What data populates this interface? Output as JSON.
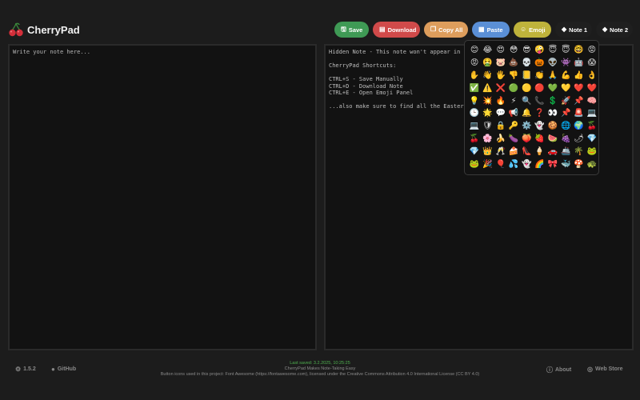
{
  "app": {
    "title": "CherryPad"
  },
  "toolbar": {
    "save": "Save",
    "download": "Download",
    "copy_all": "Copy All",
    "paste": "Paste",
    "emoji": "Emoji",
    "note1": "Note 1",
    "note2": "Note 2"
  },
  "colors": {
    "save": "#3f9a55",
    "download": "#d04a4a",
    "copy_all": "#dd9d5c",
    "paste": "#5a8fd6",
    "emoji": "#bfb33b",
    "background": "#1c1c1c",
    "panel": "#121212",
    "last_saved": "#4fb04f"
  },
  "icons": {
    "save": "floppy-disk-icon",
    "download": "file-arrow-down-icon",
    "copy_all": "copy-icon",
    "paste": "clipboard-icon",
    "emoji": "face-smile-icon",
    "note": "eraser-icon",
    "version": "gear-icon",
    "github": "github-icon",
    "about": "info-circle-icon",
    "webstore": "chrome-icon",
    "logo": "cherry-icon"
  },
  "left_note": {
    "placeholder": "Write your note here...",
    "value": ""
  },
  "right_note": {
    "content": "Hidden Note - This note won't appear in th\n\nCherryPad Shortcuts:\n\nCTRL+S - Save Manually\nCTRL+D - Download Note\nCTRL+E - Open Emoji Panel\n\n...also make sure to find all the Easter E"
  },
  "emoji_panel": {
    "emojis": [
      "😊",
      "😂",
      "😍",
      "😳",
      "😎",
      "🤪",
      "😇",
      "😇",
      "🤓",
      "😡",
      "😡",
      "🤮",
      "🐷",
      "💩",
      "💀",
      "🎃",
      "👽",
      "👾",
      "🤖",
      "😱",
      "✋",
      "👋",
      "🖐",
      "👎",
      "📒",
      "👏",
      "🙏",
      "💪",
      "👍",
      "👌",
      "✅",
      "⚠️",
      "❌",
      "🟢",
      "🟡",
      "🔴",
      "💚",
      "💛",
      "❤️",
      "❤️",
      "💡",
      "💥",
      "🔥",
      "⚡",
      "🔍",
      "📞",
      "💲",
      "🚀",
      "📌",
      "🧠",
      "🕒",
      "🌟",
      "💬",
      "📢",
      "🔔",
      "❓",
      "👀",
      "📌",
      "🚨",
      "💻",
      "💻",
      "🛡",
      "🔒",
      "🔑",
      "⚙️",
      "👻",
      "🍪",
      "🌐",
      "🌍",
      "🍒",
      "🍒",
      "🌸",
      "🍌",
      "🍆",
      "🍑",
      "🍓",
      "🍉",
      "🍇",
      "🌶",
      "💎",
      "💎",
      "👑",
      "🥂",
      "🍰",
      "👠",
      "🍦",
      "🚗",
      "🚢",
      "🌴",
      "🐸",
      "🐸",
      "🎉",
      "🎈",
      "💦",
      "👻",
      "🌈",
      "🎀",
      "🐳",
      "🍄",
      "🐢"
    ]
  },
  "footer": {
    "version": "1.5.2",
    "github": "GitHub",
    "last_saved": "Last saved: 3.2.2025, 10:25:25",
    "tagline": "CherryPad Makes Note-Taking Easy",
    "license": "Button icons used in this project: Font Awesome (https://fontawesome.com), licensed under the Creative Commons Attribution 4.0 International License (CC BY 4.0)",
    "about": "About",
    "webstore": "Web Store"
  }
}
